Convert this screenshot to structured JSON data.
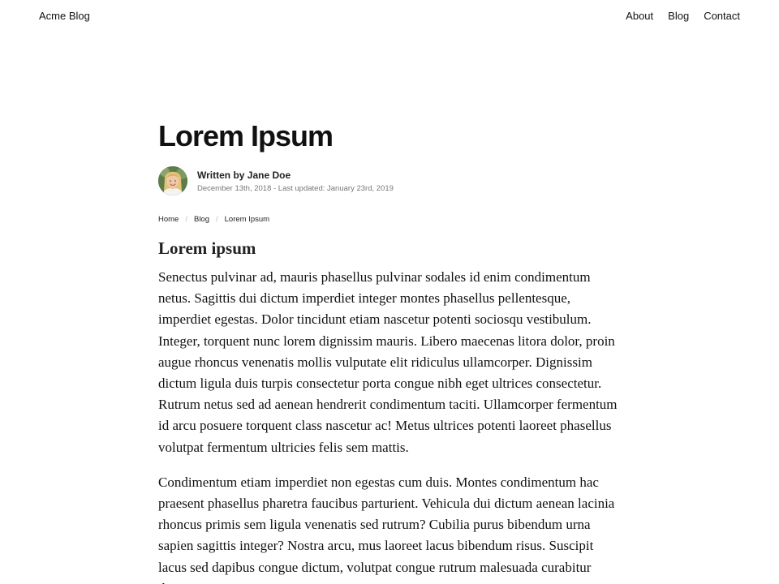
{
  "header": {
    "brand": "Acme Blog",
    "nav": [
      {
        "label": "About"
      },
      {
        "label": "Blog"
      },
      {
        "label": "Contact"
      }
    ]
  },
  "article": {
    "title": "Lorem Ipsum",
    "author_line": "Written by Jane Doe",
    "dates": "December 13th, 2018 - Last updated: January 23rd, 2019",
    "avatar": "author-avatar",
    "breadcrumb": [
      {
        "label": "Home"
      },
      {
        "label": "Blog"
      },
      {
        "label": "Lorem Ipsum"
      }
    ],
    "section_heading": "Lorem ipsum",
    "paragraphs": [
      "Senectus pulvinar ad, mauris phasellus pulvinar sodales id enim condimentum netus. Sagittis dui dictum imperdiet integer montes phasellus pellentesque, imperdiet egestas. Dolor tincidunt etiam nascetur potenti sociosqu vestibulum. Integer, torquent nunc lorem dignissim mauris. Libero maecenas litora dolor, proin augue rhoncus venenatis mollis vulputate elit ridiculus ullamcorper. Dignissim dictum ligula duis turpis consectetur porta congue nibh eget ultrices consectetur. Rutrum netus sed ad aenean hendrerit condimentum taciti. Ullamcorper fermentum id arcu posuere torquent class nascetur ac! Metus ultrices potenti laoreet phasellus volutpat fermentum ultricies felis sem mattis.",
      "Condimentum etiam imperdiet non egestas cum duis. Montes condimentum hac praesent phasellus pharetra faucibus parturient. Vehicula dui dictum aenean lacinia rhoncus primis sem ligula venenatis sed rutrum? Cubilia purus bibendum urna sapien sagittis integer? Nostra arcu, mus laoreet lacus bibendum risus. Suscipit lacus sed dapibus congue dictum, volutpat congue rutrum malesuada curabitur diam."
    ]
  },
  "colors": {
    "text": "#111111",
    "muted": "#777777",
    "separator": "#bbbbbb",
    "background": "#ffffff"
  }
}
